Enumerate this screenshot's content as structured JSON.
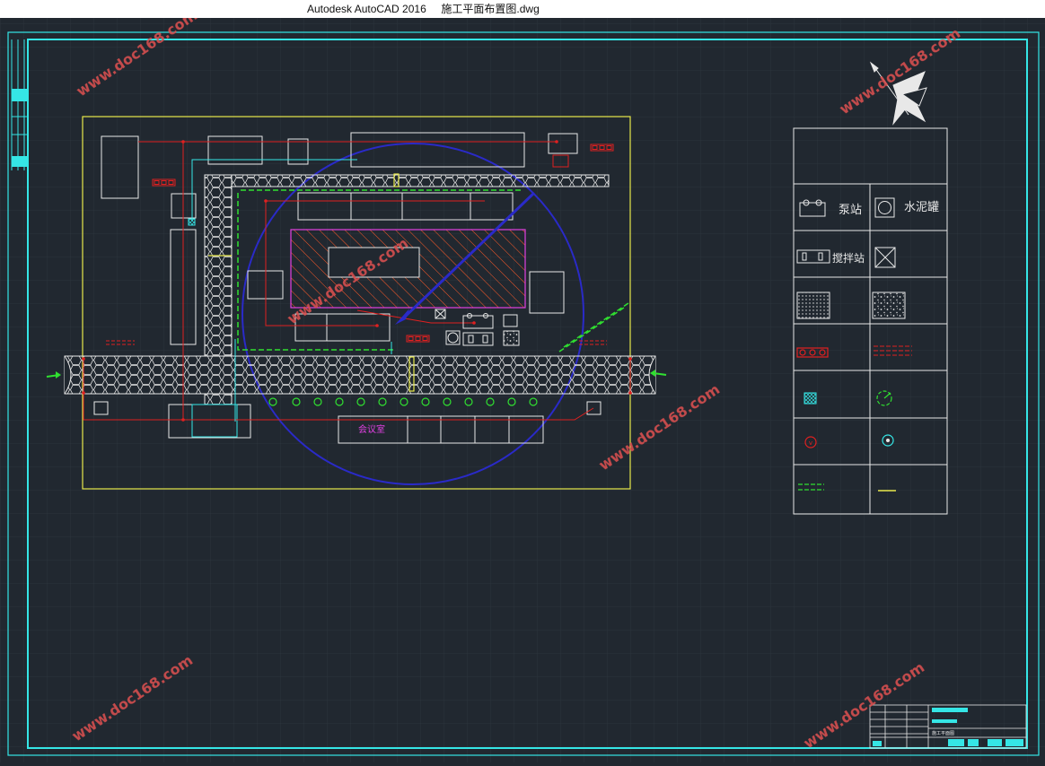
{
  "window": {
    "title": "Autodesk AutoCAD 2016     施工平面布置图.dwg"
  },
  "drawing": {
    "meeting_room_label": "会议室",
    "legend": {
      "pump_station": "泵站",
      "cement_tank": "水泥罐",
      "mixing_station": "搅拌站"
    },
    "title_block_text": "施工平面图"
  },
  "watermark": {
    "text": "www.doc168.com"
  },
  "colors": {
    "background": "#212830",
    "frame": "#35e6e6",
    "site_boundary": "#e8e84a",
    "building": "#e8e8e8",
    "crane_radius": "#2a2ac8",
    "hatch": "#ff5a28",
    "magenta": "#e040e0",
    "red_line": "#e02020",
    "green": "#30e030",
    "watermark": "#d85050"
  },
  "icons": [
    "north-arrow-icon",
    "entrance-arrow-icon",
    "tree-icon",
    "hydrant-icon",
    "valve-icon"
  ]
}
